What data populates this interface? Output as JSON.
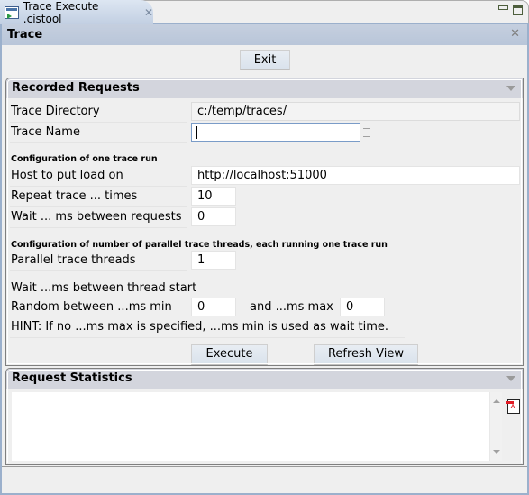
{
  "tab": {
    "icon": "trace-editor-icon",
    "title": "Trace Execute .cistool",
    "close_icon": "close-icon"
  },
  "window_controls": {
    "minimize_icon": "minimize-icon",
    "maximize_icon": "maximize-icon"
  },
  "form": {
    "title": "Trace",
    "close_icon": "close-icon",
    "exit_label": "Exit"
  },
  "recorded_requests": {
    "title": "Recorded Requests",
    "trace_directory_label": "Trace Directory",
    "trace_directory_value": "c:/temp/traces/",
    "trace_name_label": "Trace Name",
    "trace_name_value": "",
    "one_run_heading": "Configuration of one trace run",
    "host_label": "Host to put load on",
    "host_value": "http://localhost:51000",
    "repeat_label": "Repeat trace ... times",
    "repeat_value": "10",
    "wait_label": "Wait ... ms between requests",
    "wait_value": "0",
    "parallel_heading": "Configuration of number of parallel trace threads, each running one trace run",
    "threads_label": "Parallel trace threads",
    "threads_value": "1",
    "thread_start_label": "Wait ...ms between thread start",
    "random_min_label": "Random between ...ms min",
    "random_min_value": "0",
    "random_max_label": "and ...ms max",
    "random_max_value": "0",
    "hint": "HINT: If no ...ms max is specified, ...ms min is used as wait time.",
    "execute_label": "Execute",
    "refresh_label": "Refresh View"
  },
  "request_statistics": {
    "title": "Request Statistics",
    "content": "",
    "export_icon": "pdf-export-icon"
  }
}
